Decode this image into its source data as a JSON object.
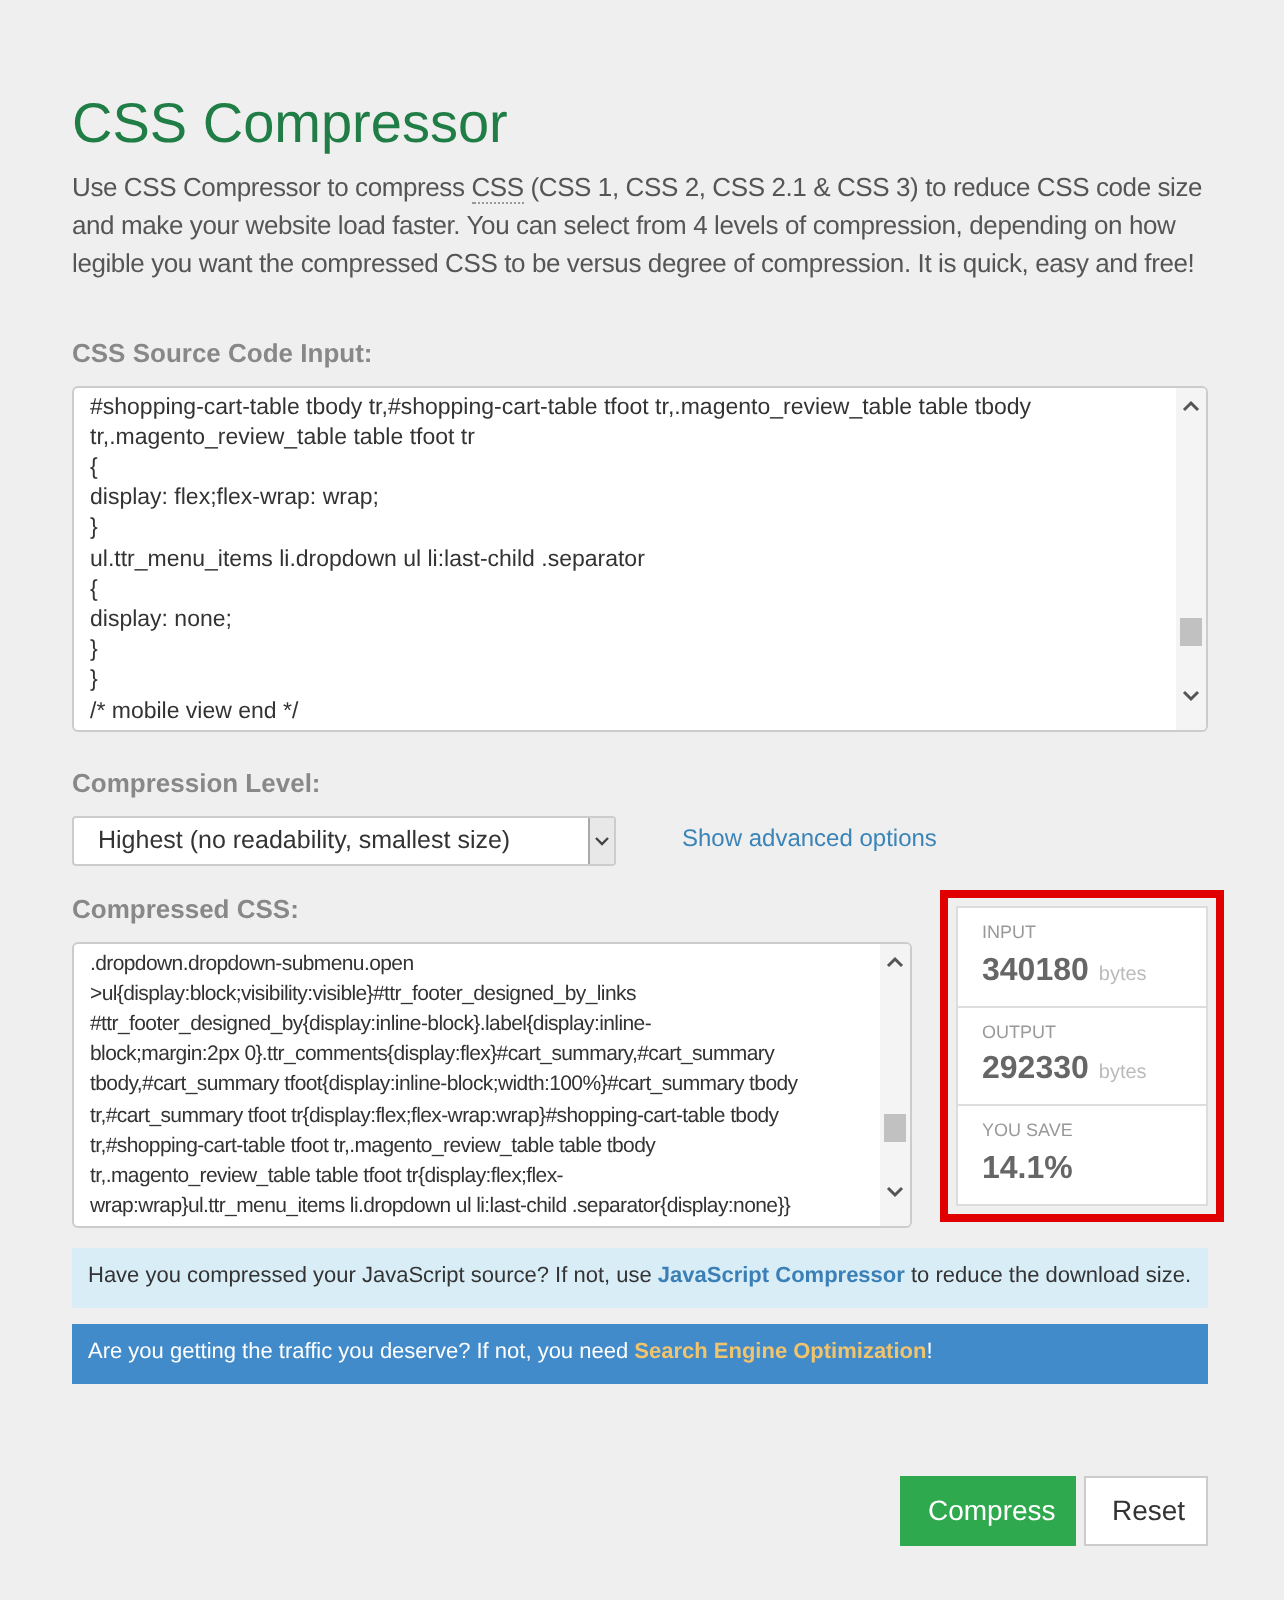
{
  "title": "CSS Compressor",
  "intro": {
    "before": "Use CSS Compressor to compress ",
    "abbr": "CSS",
    "after": " (CSS 1, CSS 2, CSS 2.1 & CSS 3) to reduce CSS code size and make your website load faster. You can select from 4 levels of compression, depending on how legible you want the compressed CSS to be versus degree of compression. It is quick, easy and free!"
  },
  "source": {
    "label": "CSS Source Code Input:",
    "lines": [
      "#shopping-cart-table tbody tr,#shopping-cart-table tfoot tr,.magento_review_table table tbody",
      "tr,.magento_review_table table tfoot tr",
      "{",
      "display: flex;flex-wrap: wrap;",
      "}",
      "ul.ttr_menu_items li.dropdown ul li:last-child .separator",
      "{",
      "display: none;",
      "}",
      "}",
      "/* mobile view end */"
    ]
  },
  "level": {
    "label": "Compression Level:",
    "value": "Highest (no readability, smallest size)",
    "link": "Show advanced options"
  },
  "output": {
    "label": "Compressed CSS:",
    "lines": [
      ".dropdown.dropdown-submenu.open",
      ">ul{display:block;visibility:visible}#ttr_footer_designed_by_links",
      "#ttr_footer_designed_by{display:inline-block}.label{display:inline-",
      "block;margin:2px 0}.ttr_comments{display:flex}#cart_summary,#cart_summary",
      "tbody,#cart_summary tfoot{display:inline-block;width:100%}#cart_summary tbody",
      "tr,#cart_summary tfoot tr{display:flex;flex-wrap:wrap}#shopping-cart-table tbody",
      "tr,#shopping-cart-table tfoot tr,.magento_review_table table tbody",
      "tr,.magento_review_table table tfoot tr{display:flex;flex-",
      "wrap:wrap}ul.ttr_menu_items li.dropdown ul li:last-child .separator{display:none}}"
    ]
  },
  "stats": [
    {
      "label": "INPUT",
      "value": "340180",
      "unit": "bytes"
    },
    {
      "label": "OUTPUT",
      "value": "292330",
      "unit": "bytes"
    },
    {
      "label": "YOU SAVE",
      "value": "14.1%"
    }
  ],
  "notices": [
    {
      "kind": "info",
      "before": "Have you compressed your JavaScript source? If not, use ",
      "link": "JavaScript Compressor",
      "after": " to reduce the download size."
    },
    {
      "kind": "primary",
      "before": "Are you getting the traffic you deserve? If not, you need ",
      "link": "Search Engine Optimization",
      "after": "!"
    }
  ],
  "buttons": [
    {
      "kind": "primary",
      "label": "Compress"
    },
    {
      "kind": "default",
      "label": "Reset"
    }
  ]
}
